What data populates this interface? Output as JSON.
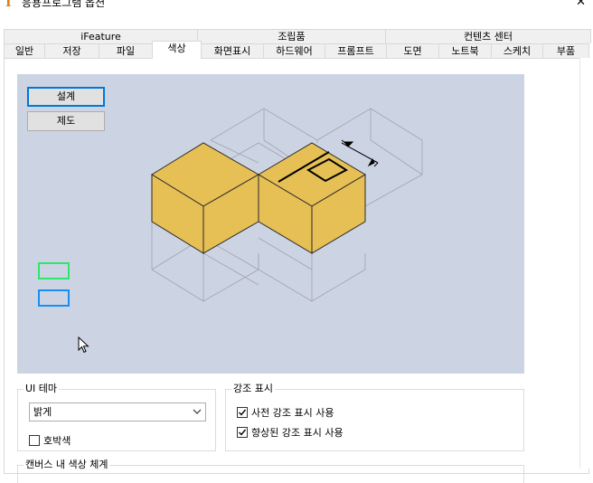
{
  "window": {
    "title": "응용프로그램 옵션",
    "close_glyph": "✕",
    "icon": "inventor-app-icon"
  },
  "tabs_row1": [
    {
      "label": "iFeature"
    },
    {
      "label": "조립품"
    },
    {
      "label": "컨텐츠 센터"
    }
  ],
  "tabs_row2": [
    {
      "label": "일반"
    },
    {
      "label": "저장"
    },
    {
      "label": "파일"
    },
    {
      "label": "색상",
      "active": true
    },
    {
      "label": "화면표시"
    },
    {
      "label": "하드웨어"
    },
    {
      "label": "프롬프트"
    },
    {
      "label": "도면"
    },
    {
      "label": "노트북"
    },
    {
      "label": "스케치"
    },
    {
      "label": "부품"
    }
  ],
  "preview": {
    "design_button": "설계",
    "drawing_button": "제도",
    "background_color": "#ccd4e4",
    "cube_color": "#e6bf55",
    "selection_color": "#2ee66b",
    "highlight_color": "#1a8ef0"
  },
  "ui_theme": {
    "legend": "UI 테마",
    "selected": "밝게",
    "amber_label": "호박색",
    "amber_checked": false
  },
  "highlight": {
    "legend": "강조 표시",
    "prehighlight_label": "사전 강조 표시 사용",
    "prehighlight_checked": true,
    "enhanced_label": "향상된 강조 표시 사용",
    "enhanced_checked": true
  },
  "canvas_scheme": {
    "legend": "캔버스 내 색상 체계"
  }
}
